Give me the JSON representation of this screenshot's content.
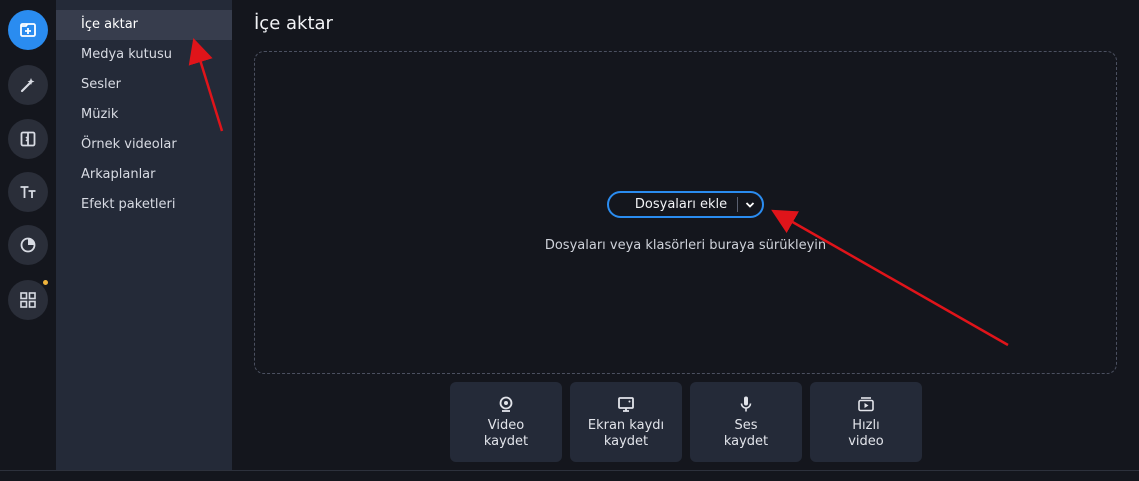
{
  "rail": {
    "items": [
      {
        "icon": "import-icon",
        "active": true
      },
      {
        "icon": "magic-wand-icon",
        "active": false
      },
      {
        "icon": "transitions-icon",
        "active": false
      },
      {
        "icon": "titles-icon",
        "active": false
      },
      {
        "icon": "stickers-icon",
        "active": false
      },
      {
        "icon": "more-tools-icon",
        "active": false,
        "notification": true
      }
    ]
  },
  "menu": {
    "items": [
      {
        "label": "İçe aktar",
        "active": true
      },
      {
        "label": "Medya kutusu"
      },
      {
        "label": "Sesler"
      },
      {
        "label": "Müzik"
      },
      {
        "label": "Örnek videolar"
      },
      {
        "label": "Arkaplanlar"
      },
      {
        "label": "Efekt paketleri"
      }
    ]
  },
  "main": {
    "title": "İçe aktar",
    "add_button": "Dosyaları ekle",
    "drop_hint": "Dosyaları veya klasörleri buraya sürükleyin"
  },
  "tiles": [
    {
      "label_line1": "Video",
      "label_line2": "kaydet",
      "icon": "webcam-icon"
    },
    {
      "label_line1": "Ekran kaydı",
      "label_line2": "kaydet",
      "icon": "monitor-icon"
    },
    {
      "label_line1": "Ses",
      "label_line2": "kaydet",
      "icon": "microphone-icon"
    },
    {
      "label_line1": "Hızlı",
      "label_line2": "video",
      "icon": "quick-video-icon"
    }
  ],
  "colors": {
    "accent": "#2a8cf0",
    "annotation_arrow": "#e0141a",
    "notification_dot": "#f0b43c"
  }
}
